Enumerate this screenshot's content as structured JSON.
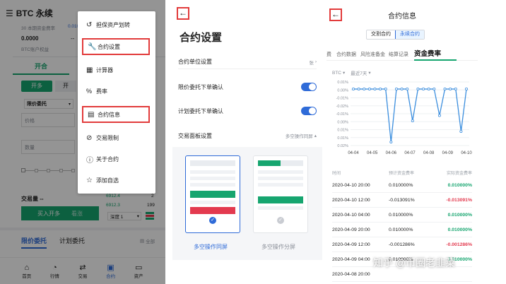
{
  "left": {
    "title": "BTC 永续",
    "funding_label": "30 本期资金费率",
    "funding_value": "0.010",
    "balance_value": "0.0000",
    "balance_dash": "--",
    "balance_label": "BTC账户权益",
    "tab_open": "开合",
    "btn_long": "开多",
    "btn_short": "开",
    "order_type": "限价委托",
    "price_placeholder": "价格",
    "qty_placeholder": "数量",
    "volume_label": "交易量 --",
    "ob_rows": [
      {
        "price": "6912.4",
        "qty": "2"
      },
      {
        "price": "6912.3",
        "qty": "199"
      }
    ],
    "buy_button": "买入开多",
    "sell_button": "看涨",
    "depth_select": "深度 1",
    "tab_limit": "限价委托",
    "tab_plan": "计划委托",
    "all_label": "全部",
    "nav": [
      {
        "label": "首页",
        "icon": "home-icon"
      },
      {
        "label": "行情",
        "icon": "market-icon"
      },
      {
        "label": "交易",
        "icon": "trade-icon"
      },
      {
        "label": "合约",
        "icon": "contract-icon"
      },
      {
        "label": "资产",
        "icon": "wallet-icon"
      }
    ],
    "menu": [
      {
        "label": "担保资产划转",
        "icon": "transfer-icon",
        "highlight": false
      },
      {
        "label": "合约设置",
        "icon": "wrench-icon",
        "highlight": true
      },
      {
        "label": "计算器",
        "icon": "calculator-icon",
        "highlight": false
      },
      {
        "label": "费率",
        "icon": "percent-icon",
        "highlight": false
      },
      {
        "label": "合约信息",
        "icon": "document-icon",
        "highlight": true
      },
      {
        "label": "交易限制",
        "icon": "block-icon",
        "highlight": false
      },
      {
        "label": "关于合约",
        "icon": "info-icon",
        "highlight": false
      },
      {
        "label": "添加自选",
        "icon": "star-icon",
        "highlight": false
      }
    ]
  },
  "middle": {
    "title": "合约设置",
    "rows": [
      {
        "label": "合约单位设置",
        "value": "张",
        "type": "link"
      },
      {
        "label": "限价委托下单确认",
        "value": "",
        "type": "toggle"
      },
      {
        "label": "计划委托下单确认",
        "value": "",
        "type": "toggle"
      },
      {
        "label": "交易面板设置",
        "value": "多空操作同屏",
        "type": "dropdown"
      }
    ],
    "option_same": "多空操作同屏",
    "option_split": "多空操作分屏"
  },
  "right": {
    "title": "合约信息",
    "seg_delivery": "交割合约",
    "seg_perpetual": "永续合约",
    "tabs": [
      "费",
      "合约数据",
      "风险准备金",
      "结算记录",
      "资金费率"
    ],
    "filter_coin": "BTC",
    "filter_range": "最近7天",
    "table_headers": [
      "时间",
      "预计资金费率",
      "实际资金费率"
    ],
    "rows": [
      {
        "time": "2020-04-10 20:00",
        "expected": "0.010000%",
        "actual": "0.010000%",
        "sign": "pos"
      },
      {
        "time": "2020-04-10 12:00",
        "expected": "-0.013091%",
        "actual": "-0.013091%",
        "sign": "neg"
      },
      {
        "time": "2020-04-10 04:00",
        "expected": "0.010000%",
        "actual": "0.010000%",
        "sign": "pos"
      },
      {
        "time": "2020-04-09 20:00",
        "expected": "0.010000%",
        "actual": "0.010000%",
        "sign": "pos"
      },
      {
        "time": "2020-04-09 12:00",
        "expected": "-0.001286%",
        "actual": "-0.001286%",
        "sign": "neg"
      },
      {
        "time": "2020-04-09 04:00",
        "expected": "0.010000%",
        "actual": "0.010000%",
        "sign": "pos"
      },
      {
        "time": "2020-04-08 20:00",
        "expected": "",
        "actual": "",
        "sign": "pos"
      }
    ],
    "watermark": "知乎 @币圈老韭菜",
    "colors": {
      "line": "#3b8ede",
      "pos": "#16a56f",
      "neg": "#e33a4f",
      "accent": "#16a56f",
      "highlight_box": "#e23b3b"
    }
  },
  "chart_data": {
    "type": "line",
    "categories": [
      "04-04",
      "04-05",
      "04-06",
      "04-07",
      "04-08",
      "04-09",
      "04-10"
    ],
    "y_ticks": [
      "0.01%",
      "0.00%",
      "-0.01%",
      "-0.02%",
      "-0.01%",
      "0.00%",
      "0.01%",
      "0.01%",
      "0.02%"
    ],
    "ylim": [
      -0.022,
      0.014
    ],
    "series": [
      {
        "values": [
          0.01,
          0.01,
          0.01,
          0.01,
          0.01,
          0.01,
          0.01,
          -0.02,
          0.01,
          0.01,
          0.01,
          -0.008,
          0.01,
          0.01,
          0.01,
          0.01,
          -0.005,
          0.01,
          0.01,
          0.01,
          -0.014,
          0.01
        ]
      }
    ],
    "grid": true
  }
}
